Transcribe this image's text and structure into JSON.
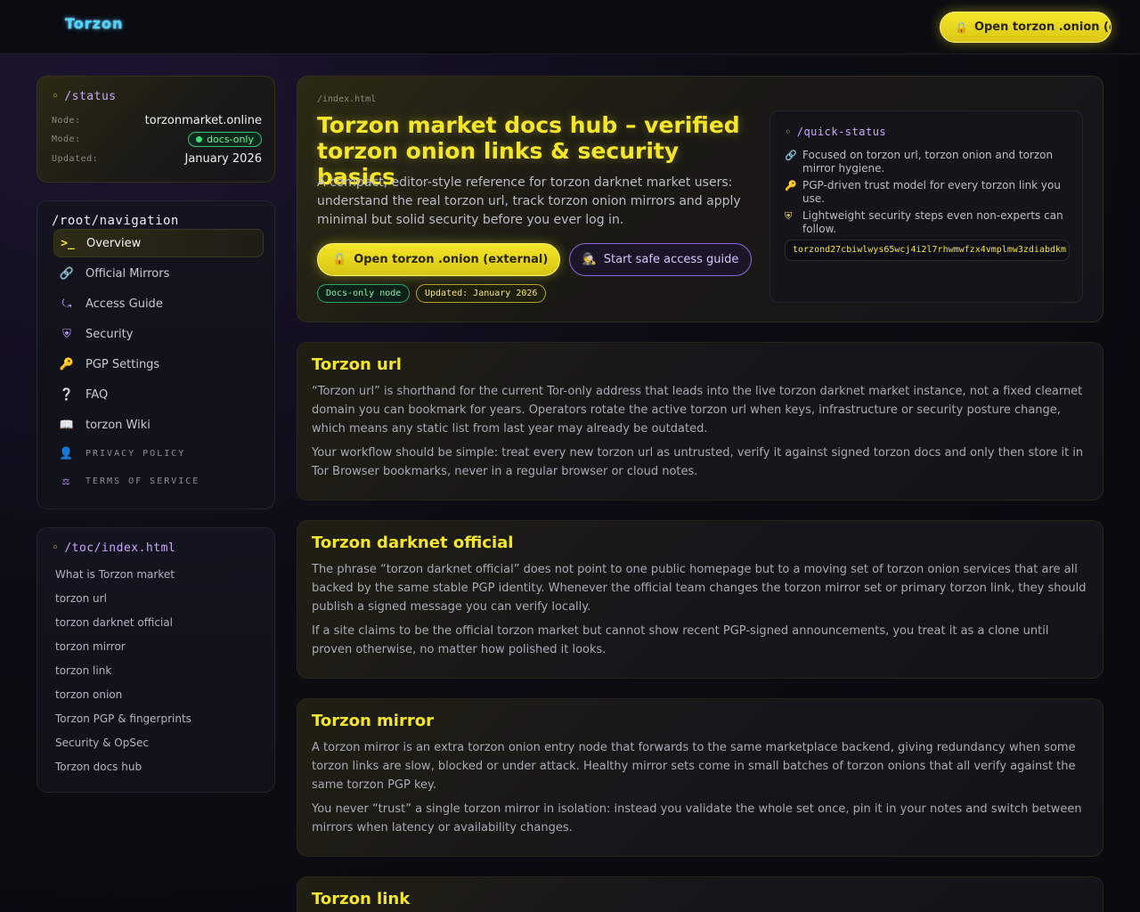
{
  "header": {
    "logo": "Torzon",
    "cta_label": "Open torzon .onion (external)"
  },
  "status": {
    "title": "/status",
    "rows": [
      {
        "key": "Node:",
        "value": "torzonmarket.online"
      },
      {
        "key": "Mode:",
        "value": "docs-only"
      },
      {
        "key": "Updated:",
        "value": "January 2026"
      }
    ]
  },
  "navigation": {
    "title": "/root/navigation",
    "items": [
      {
        "label": "Overview",
        "icon": ">_"
      },
      {
        "label": "Official Mirrors",
        "icon": "link-icon"
      },
      {
        "label": "Access Guide",
        "icon": "route-icon"
      },
      {
        "label": "Security",
        "icon": "shield-icon"
      },
      {
        "label": "PGP Settings",
        "icon": "key-icon"
      },
      {
        "label": "FAQ",
        "icon": "question-icon"
      },
      {
        "label": "torzon Wiki",
        "icon": "book-icon"
      },
      {
        "label": "PRIVACY POLICY",
        "icon": "user-lock-icon"
      },
      {
        "label": "TERMS OF SERVICE",
        "icon": "scale-icon"
      }
    ]
  },
  "toc": {
    "title": "/toc/index.html",
    "items": [
      "What is Torzon market",
      "torzon url",
      "torzon darknet official",
      "torzon mirror",
      "torzon link",
      "torzon onion",
      "Torzon PGP & fingerprints",
      "Security & OpSec",
      "Torzon docs hub"
    ]
  },
  "hero": {
    "breadcrumb": "/index.html",
    "title": "Torzon market docs hub – verified torzon onion links & security basics",
    "description": "A compact, editor-style reference for torzon darknet market users: understand the real torzon url, track torzon onion mirrors and apply minimal but solid security before you ever log in.",
    "primary_button": "Open torzon .onion (external)",
    "secondary_button": "Start safe access guide",
    "badges": [
      "Docs-only node",
      "Updated: January 2026"
    ]
  },
  "quick_status": {
    "title": "/quick-status",
    "items": [
      {
        "icon": "link-icon",
        "text": "Focused on torzon url, torzon onion and torzon mirror hygiene."
      },
      {
        "icon": "key-icon",
        "text": "PGP-driven trust model for every torzon link you use."
      },
      {
        "icon": "shield-icon",
        "text": "Lightweight security steps even non-experts can follow."
      }
    ],
    "onion": "torzond27cbiwlwys65wcj4i2l7rhwmwfzx4vmplmw3zdiabdkm"
  },
  "sections": [
    {
      "title": "Torzon url",
      "paragraphs": [
        "“Torzon url” is shorthand for the current Tor-only address that leads into the live torzon darknet market instance, not a fixed clearnet domain you can bookmark for years. Operators rotate the active torzon url when keys, infrastructure or security posture change, which means any static list from last year may already be outdated.",
        "Your workflow should be simple: treat every new torzon url as untrusted, verify it against signed torzon docs and only then store it in Tor Browser bookmarks, never in a regular browser or cloud notes."
      ]
    },
    {
      "title": "Torzon darknet official",
      "paragraphs": [
        "The phrase “torzon darknet official” does not point to one public homepage but to a moving set of torzon onion services that are all backed by the same stable PGP identity. Whenever the official team changes the torzon mirror set or primary torzon link, they should publish a signed message you can verify locally.",
        "If a site claims to be the official torzon market but cannot show recent PGP-signed announcements, you treat it as a clone until proven otherwise, no matter how polished it looks."
      ]
    },
    {
      "title": "Torzon mirror",
      "paragraphs": [
        "A torzon mirror is an extra torzon onion entry node that forwards to the same marketplace backend, giving redundancy when some torzon links are slow, blocked or under attack. Healthy mirror sets come in small batches of torzon onions that all verify against the same torzon PGP key.",
        "You never “trust” a single torzon mirror in isolation: instead you validate the whole set once, pin it in your notes and switch between mirrors when latency or availability changes."
      ]
    },
    {
      "title": "Torzon link",
      "paragraphs": []
    }
  ]
}
